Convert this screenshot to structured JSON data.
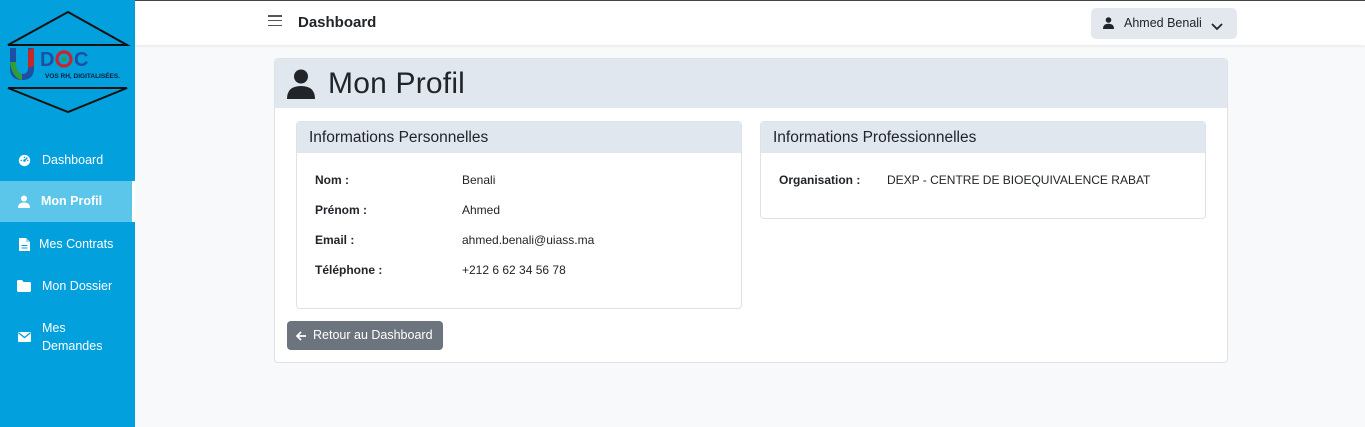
{
  "brand": {
    "logo_text": "UDOC",
    "logo_tagline": "VOS RH, DIGITALISÉES."
  },
  "sidebar": {
    "items": [
      {
        "label": "Dashboard",
        "icon": "dashboard-gauge-icon"
      },
      {
        "label": "Mon Profil",
        "icon": "user-icon",
        "active": true
      },
      {
        "label": "Mes Contrats",
        "icon": "file-icon"
      },
      {
        "label": "Mon Dossier",
        "icon": "folder-icon"
      },
      {
        "label": "Mes Demandes",
        "icon": "envelope-icon"
      }
    ]
  },
  "topbar": {
    "title": "Dashboard",
    "user_name": "Ahmed Benali"
  },
  "page": {
    "title": "Mon Profil"
  },
  "personal": {
    "title": "Informations Personnelles",
    "rows": [
      {
        "key": "Nom :",
        "value": "Benali"
      },
      {
        "key": "Prénom :",
        "value": "Ahmed"
      },
      {
        "key": "Email :",
        "value": "ahmed.benali@uiass.ma"
      },
      {
        "key": "Téléphone :",
        "value": "+212 6 62 34 56 78"
      }
    ]
  },
  "professional": {
    "title": "Informations Professionnelles",
    "rows": [
      {
        "key": "Organisation :",
        "value": "DEXP - CENTRE DE BIOEQUIVALENCE RABAT"
      }
    ]
  },
  "back_button": {
    "label": "Retour au Dashboard"
  },
  "colors": {
    "sidebar": "#02a0dd",
    "active": "#5cc6ea",
    "header_bg": "#e1e7ef",
    "button": "#6c757d"
  }
}
